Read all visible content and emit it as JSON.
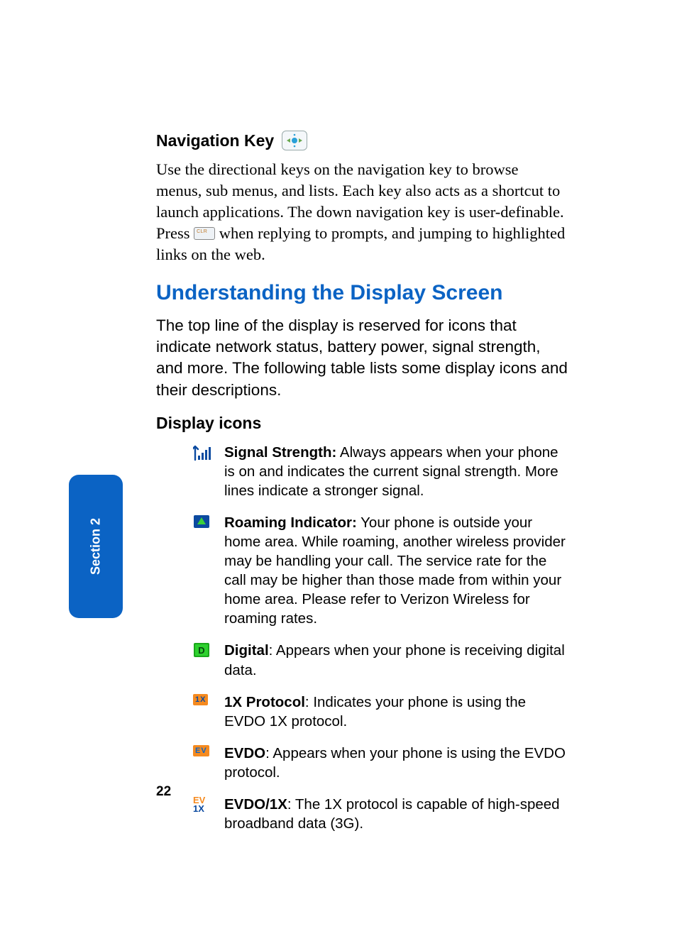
{
  "nav": {
    "heading": "Navigation Key",
    "body_before_key": "Use the directional keys on the navigation key to browse menus, sub menus, and lists. Each key also acts as a shortcut to launch applications. The down navigation key is user-definable. Press ",
    "body_after_key": " when replying to prompts, and jumping to highlighted links on the web."
  },
  "section": {
    "heading": "Understanding the Display Screen",
    "intro": "The top line of the display is reserved for icons that indicate network status, battery power, signal strength, and more. The following table lists some display icons and their descriptions.",
    "sub_heading": "Display icons"
  },
  "icons": [
    {
      "name": "signal-strength-icon",
      "term": "Signal Strength:",
      "sep": " ",
      "desc": "Always appears when your phone is on and indicates the current signal strength. More lines indicate a stronger signal."
    },
    {
      "name": "roaming-indicator-icon",
      "term": "Roaming Indicator:",
      "sep": " ",
      "desc": "Your phone is outside your home area. While roaming, another wireless provider may be handling your call. The service rate for the call may be higher than those made from within your home area. Please refer to Verizon Wireless for roaming rates."
    },
    {
      "name": "digital-icon",
      "term": "Digital",
      "sep": ": ",
      "desc": "Appears when your phone is receiving digital data."
    },
    {
      "name": "1x-protocol-icon",
      "term": "1X Protocol",
      "sep": ": ",
      "desc": "Indicates your phone is using the EVDO 1X protocol."
    },
    {
      "name": "evdo-icon",
      "term": "EVDO",
      "sep": ": ",
      "desc": "Appears when your phone is using the EVDO protocol."
    },
    {
      "name": "evdo-1x-icon",
      "term": "EVDO/1X",
      "sep": ": ",
      "desc": "The 1X protocol is capable of high-speed broadband data (3G)."
    }
  ],
  "side_tab": "Section 2",
  "page_number": "22"
}
